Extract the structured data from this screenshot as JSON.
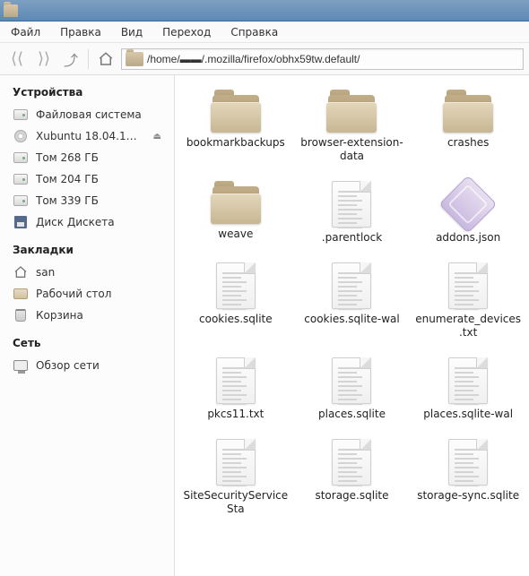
{
  "window": {
    "title": ""
  },
  "menu": {
    "file": "Файл",
    "edit": "Правка",
    "view": "Вид",
    "go": "Переход",
    "help": "Справка"
  },
  "toolbar": {
    "path": "/home/▬▬/.mozilla/firefox/obhx59tw.default/"
  },
  "sidebar": {
    "sections": {
      "devices": "Устройства",
      "bookmarks": "Закладки",
      "network": "Сеть"
    },
    "devices": [
      {
        "label": "Файловая система",
        "icon": "drive"
      },
      {
        "label": "Xubuntu 18.04.1…",
        "icon": "cd",
        "eject": true
      },
      {
        "label": "Том 268 ГБ",
        "icon": "drive"
      },
      {
        "label": "Том 204 ГБ",
        "icon": "drive"
      },
      {
        "label": "Том 339 ГБ",
        "icon": "drive"
      },
      {
        "label": "Диск Дискета",
        "icon": "floppy"
      }
    ],
    "bookmarks": [
      {
        "label": "san",
        "icon": "home"
      },
      {
        "label": "Рабочий стол",
        "icon": "desktop"
      },
      {
        "label": "Корзина",
        "icon": "trash"
      }
    ],
    "network": [
      {
        "label": "Обзор сети",
        "icon": "network"
      }
    ]
  },
  "files": [
    {
      "name": "bookmarkbackups",
      "type": "folder"
    },
    {
      "name": "browser-extension-data",
      "type": "folder"
    },
    {
      "name": "crashes",
      "type": "folder"
    },
    {
      "name": "weave",
      "type": "folder"
    },
    {
      "name": ".parentlock",
      "type": "file"
    },
    {
      "name": "addons.json",
      "type": "addon"
    },
    {
      "name": "cookies.sqlite",
      "type": "file"
    },
    {
      "name": "cookies.sqlite-wal",
      "type": "file"
    },
    {
      "name": "enumerate_devices.txt",
      "type": "file"
    },
    {
      "name": "pkcs11.txt",
      "type": "file"
    },
    {
      "name": "places.sqlite",
      "type": "file"
    },
    {
      "name": "places.sqlite-wal",
      "type": "file"
    },
    {
      "name": "SiteSecurityServiceSta",
      "type": "file"
    },
    {
      "name": "storage.sqlite",
      "type": "file"
    },
    {
      "name": "storage-sync.sqlite",
      "type": "file"
    }
  ]
}
